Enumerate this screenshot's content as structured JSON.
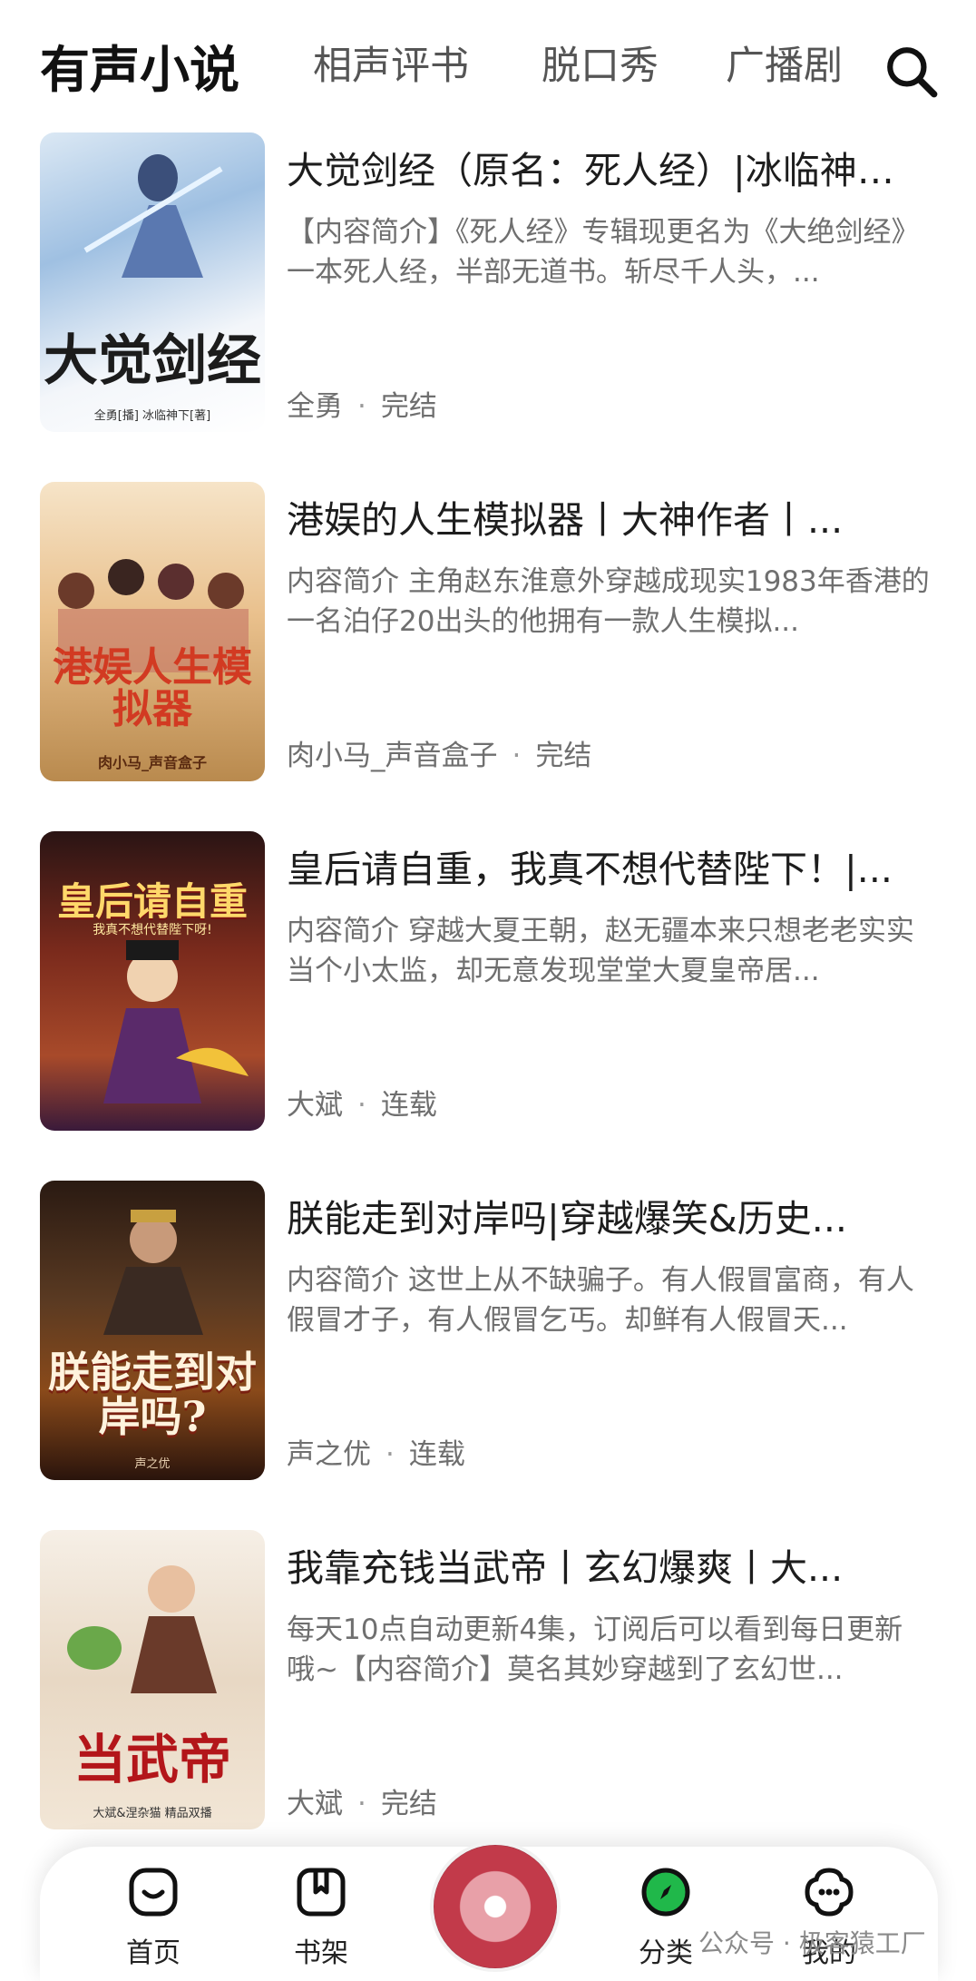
{
  "tabs": [
    "有声小说",
    "相声评书",
    "脱口秀",
    "广播剧"
  ],
  "books": [
    {
      "title": "大觉剑经（原名：死人经）|冰临神下著|...",
      "desc": "【内容简介】《死人经》专辑现更名为《大绝剑经》一本死人经，半部无道书。斩尽千人头，...",
      "narrator": "全勇",
      "status": "完结",
      "cover_title": "大觉剑经",
      "cover_sub": "全勇[播] 冰临神下[著]"
    },
    {
      "title": "港娱的人生模拟器丨大神作者丨...",
      "desc": "内容简介 主角赵东淮意外穿越成现实1983年香港的一名泊仔20出头的他拥有一款人生模拟...",
      "narrator": "肉小马_声音盒子",
      "status": "完结",
      "cover_title": "港娱人生模拟器",
      "cover_sub": "肉小马_声音盒子"
    },
    {
      "title": "皇后请自重，我真不想代替陛下！|...",
      "desc": "内容简介 穿越大夏王朝，赵无疆本来只想老老实实当个小太监，却无意发现堂堂大夏皇帝居...",
      "narrator": "大斌",
      "status": "连载",
      "cover_title": "皇后请自重",
      "cover_sub": "我真不想代替陛下呀!"
    },
    {
      "title": "朕能走到对岸吗|穿越爆笑&历史...",
      "desc": "内容简介 这世上从不缺骗子。有人假冒富商，有人假冒才子，有人假冒乞丐。却鲜有人假冒天...",
      "narrator": "声之优",
      "status": "连载",
      "cover_title": "朕能走到对岸吗?",
      "cover_sub": "声之优"
    },
    {
      "title": "我靠充钱当武帝丨玄幻爆爽丨大...",
      "desc": "每天10点自动更新4集，订阅后可以看到每日更新哦~【内容简介】莫名其妙穿越到了玄幻世...",
      "narrator": "大斌",
      "status": "完结",
      "cover_title": "当武帝",
      "cover_sub": "大斌&涅杂猫 精品双播"
    }
  ],
  "nav": {
    "home": "首页",
    "shelf": "书架",
    "category": "分类",
    "mine": "我的"
  },
  "watermark": "公众号 · 极客猿工厂",
  "colors": {
    "accent_green": "#20b84a",
    "card_bg": "#ffffff"
  }
}
